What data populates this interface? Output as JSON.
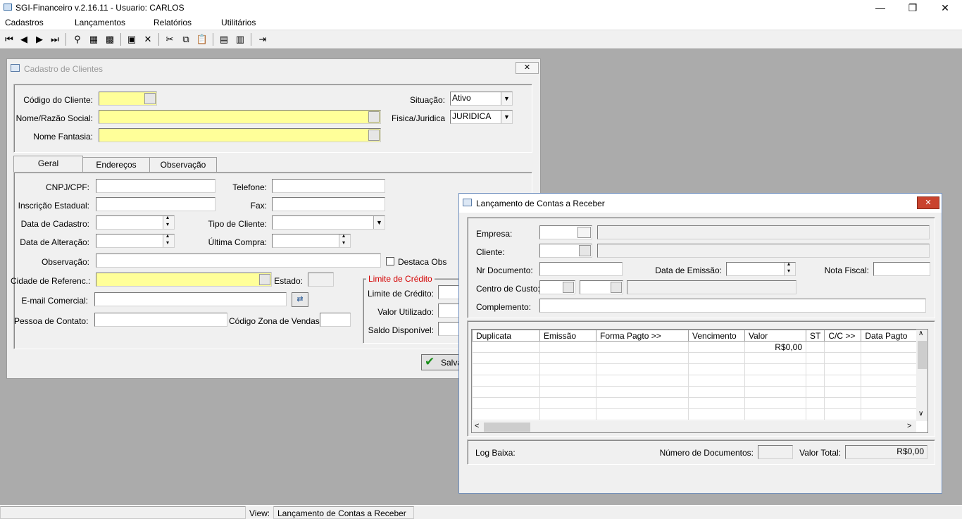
{
  "app": {
    "title": "SGI-Financeiro v.2.16.11 - Usuario: CARLOS"
  },
  "window_controls": {
    "minimize": "—",
    "maximize": "❐",
    "close": "✕"
  },
  "menu": [
    "Cadastros",
    "Lançamentos",
    "Relatórios",
    "Utilitários"
  ],
  "toolbar_icons": [
    "first-record-icon",
    "prev-record-icon",
    "next-record-icon",
    "last-record-icon",
    "search-icon",
    "filter-icon",
    "clear-filter-icon",
    "save-icon",
    "delete-icon",
    "cut-icon",
    "copy-icon",
    "paste-icon",
    "calculator-icon",
    "calendar-icon",
    "exit-icon"
  ],
  "clientes": {
    "title": "Cadastro de Clientes",
    "codigo_label": "Código do Cliente:",
    "nome_label": "Nome/Razão Social:",
    "fantasia_label": "Nome Fantasia:",
    "situacao_label": "Situação:",
    "situacao_value": "Ativo",
    "fisica_label": "Fisica/Juridica",
    "fisica_value": "JURIDICA",
    "tabs": [
      "Geral",
      "Endereços",
      "Observação"
    ],
    "cnpj_label": "CNPJ/CPF:",
    "telefone_label": "Telefone:",
    "ie_label": "Inscrição Estadual:",
    "fax_label": "Fax:",
    "data_cadastro_label": "Data de Cadastro:",
    "tipo_cliente_label": "Tipo de Cliente:",
    "data_alteracao_label": "Data de Alteração:",
    "ultima_compra_label": "Última Compra:",
    "observacao_label": "Observação:",
    "destaca_obs_label": "Destaca Obs",
    "cidade_label": "Cidade de Referenc.:",
    "estado_label": "Estado:",
    "email_label": "E-mail Comercial:",
    "contato_label": "Pessoa de Contato:",
    "zona_label": "Código Zona de Vendas:",
    "limite_group": "Limite de Crédito",
    "limite_label": "Limite de Crédito:",
    "valor_utilizado_label": "Valor Utilizado:",
    "saldo_label": "Saldo Disponível:",
    "salvar_label": "Salva"
  },
  "receber": {
    "title": "Lançamento de Contas a Receber",
    "empresa_label": "Empresa:",
    "cliente_label": "Cliente:",
    "nr_doc_label": "Nr Documento:",
    "data_emissao_label": "Data de Emissão:",
    "nota_fiscal_label": "Nota Fiscal:",
    "centro_custo_label": "Centro de Custo:",
    "complemento_label": "Complemento:",
    "grid_columns": [
      "Duplicata",
      "Emissão",
      "Forma Pagto >>",
      "Vencimento",
      "Valor",
      "ST",
      "C/C >>",
      "Data Pagto"
    ],
    "grid_rows": [
      [
        "",
        "",
        "",
        "",
        "R$0,00",
        "",
        "",
        ""
      ]
    ],
    "log_baixa_label": "Log Baixa:",
    "num_docs_label": "Número de Documentos:",
    "valor_total_label": "Valor Total:",
    "valor_total_value": "R$0,00"
  },
  "status": {
    "view_label": "View:",
    "view_value": "Lançamento de Contas a Receber"
  }
}
